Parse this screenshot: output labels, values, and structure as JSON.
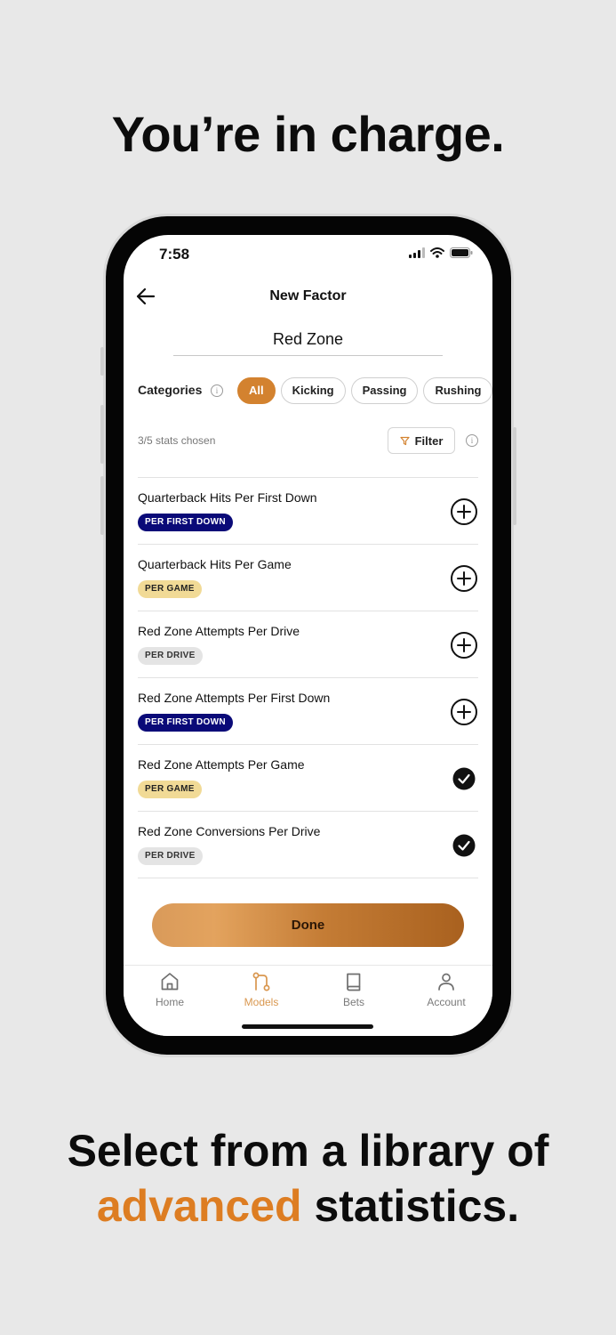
{
  "headline": "You’re in charge.",
  "bottom_copy": {
    "line1": "Select from a library of",
    "accent": "advanced",
    "rest": " statistics."
  },
  "status_bar": {
    "time": "7:58"
  },
  "nav": {
    "title": "New Factor"
  },
  "factor_name": "Red Zone",
  "categories": {
    "label": "Categories",
    "chips": [
      "All",
      "Kicking",
      "Passing",
      "Rushing"
    ],
    "selected": "All"
  },
  "stats": {
    "chosen_text": "3/5 stats chosen",
    "filter_label": "Filter"
  },
  "list": [
    {
      "title": "Quarterback Hits Per First Down",
      "badge": "PER FIRST DOWN",
      "badge_style": "blue",
      "selected": false
    },
    {
      "title": "Quarterback Hits Per Game",
      "badge": "PER GAME",
      "badge_style": "yellow",
      "selected": false
    },
    {
      "title": "Red Zone Attempts Per Drive",
      "badge": "PER DRIVE",
      "badge_style": "gray",
      "selected": false
    },
    {
      "title": "Red Zone Attempts Per First Down",
      "badge": "PER FIRST DOWN",
      "badge_style": "blue",
      "selected": false
    },
    {
      "title": "Red Zone Attempts Per Game",
      "badge": "PER GAME",
      "badge_style": "yellow",
      "selected": true
    },
    {
      "title": "Red Zone Conversions Per Drive",
      "badge": "PER DRIVE",
      "badge_style": "gray",
      "selected": true
    }
  ],
  "done_label": "Done",
  "tabs": [
    {
      "label": "Home",
      "icon": "home-icon",
      "active": false
    },
    {
      "label": "Models",
      "icon": "models-icon",
      "active": true
    },
    {
      "label": "Bets",
      "icon": "book-icon",
      "active": false
    },
    {
      "label": "Account",
      "icon": "person-icon",
      "active": false
    }
  ],
  "colors": {
    "accent": "#dd7d22",
    "chip_active": "#d3822f",
    "badge_blue": "#0a0a78",
    "badge_yellow": "#f1da96",
    "badge_gray": "#e4e4e4"
  }
}
